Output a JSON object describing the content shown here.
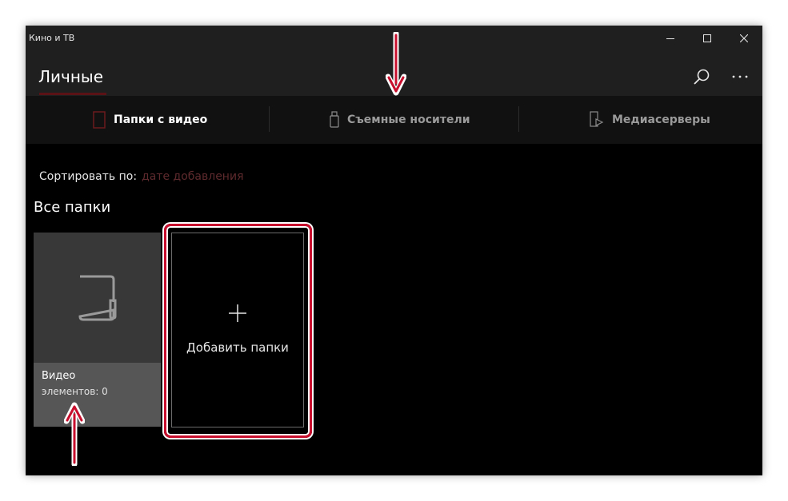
{
  "window": {
    "title": "Кино и ТВ"
  },
  "header": {
    "active_tab": "Личные"
  },
  "pivot": {
    "items": [
      {
        "label": "Папки с видео",
        "selected": true
      },
      {
        "label": "Съемные носители",
        "selected": false
      },
      {
        "label": "Медиасерверы",
        "selected": false
      }
    ]
  },
  "sort": {
    "label": "Сортировать по:",
    "value": "дате добавления"
  },
  "section": {
    "title": "Все папки"
  },
  "folders": [
    {
      "name": "Видео",
      "count": "элементов: 0"
    }
  ],
  "add_tile": {
    "label": "Добавить папки"
  },
  "colors": {
    "accent": "#5a1216",
    "annotation_red": "#c8102e",
    "window_bg": "#000000",
    "chrome_bg": "#1f1f1f"
  },
  "icons": {
    "search": "search-icon",
    "more": "more-icon",
    "folder": "folder-icon",
    "usb": "usb-icon",
    "media_server": "media-server-icon",
    "plus": "plus-icon"
  }
}
